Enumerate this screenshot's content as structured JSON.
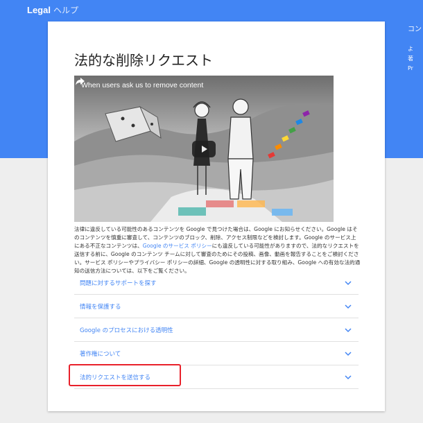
{
  "header": {
    "brand_bold": "Legal",
    "brand_suffix": "ヘルプ"
  },
  "right_panel": {
    "title": "コン",
    "lines": [
      "よ",
      "著",
      "Pr"
    ]
  },
  "page": {
    "title": "法的な削除リクエスト"
  },
  "video": {
    "title": "When users ask us to remove content"
  },
  "description": {
    "part1": "法律に違反している可能性のあるコンテンツを Google で見つけた場合は、Google にお知らせください。Google はそのコンテンツを慎重に審査して、コンテンツのブロック、削除、アクセス制限などを検討します。Google のサービス上にある不正なコンテンツは、",
    "link": "Google のサービス ポリシー",
    "part2": "にも違反している可能性がありますので、法的なリクエストを送信する前に、Google のコンテンツ チームに対して審査のためにその投稿、画像、動画を報告することをご検討ください。サービス ポリシーやプライバシー ポリシーの詳細、Google の透明性に対する取り組み、Google への有効な法的通知の送信方法については、以下をご覧ください。"
  },
  "accordion": {
    "items": [
      {
        "label": "問題に対するサポートを探す"
      },
      {
        "label": "情報を保護する"
      },
      {
        "label": "Google のプロセスにおける透明性"
      },
      {
        "label": "著作権について"
      },
      {
        "label": "法的リクエストを送信する"
      }
    ]
  },
  "colors": {
    "header_blue": "#4285f4",
    "link_blue": "#4285f4",
    "highlight_red": "#e8202a",
    "page_bg": "#eeeeee"
  },
  "icons": {
    "share": "share-icon",
    "play": "play-icon",
    "chevron": "chevron-down-icon"
  }
}
